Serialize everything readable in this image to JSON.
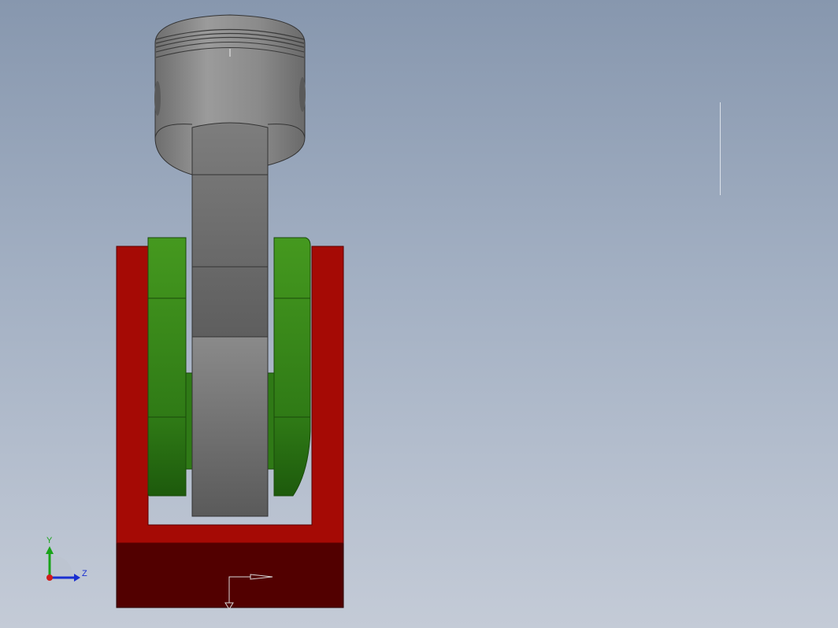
{
  "window": {
    "background_top": "#8797ae",
    "background_bottom": "#c4cbd7"
  },
  "model": {
    "frame_color": "#a50a05",
    "base_color": "#520000",
    "crank_color": "#3b8a1f",
    "piston_color": "#8a8a8a",
    "rod_color": "#7c7c7c"
  },
  "triad": {
    "y_label": "Y",
    "z_label": "Z",
    "y_color": "#19a319",
    "z_color": "#1a2fd1",
    "x_color": "#d11a1a"
  }
}
